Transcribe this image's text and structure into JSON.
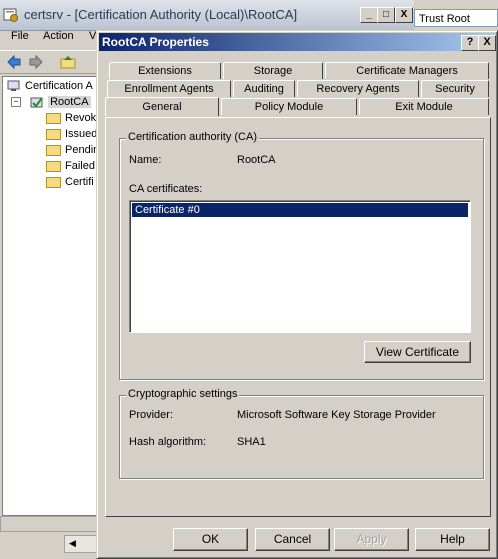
{
  "mmc": {
    "title": "certsrv - [Certification Authority (Local)\\RootCA]",
    "trust_box": "Trust Root",
    "menu": [
      "File",
      "Action",
      "V"
    ],
    "tree": {
      "root": "Certification A",
      "ca": "RootCA",
      "folders": [
        "Revok",
        "Issued",
        "Pendin",
        "Failed",
        "Certifi"
      ]
    },
    "win_buttons": [
      "_",
      "□",
      "X"
    ]
  },
  "dialog": {
    "title": "RootCA Properties",
    "help_btn": "?",
    "close_btn": "X",
    "tabs_row1": [
      "Extensions",
      "Storage",
      "Certificate Managers"
    ],
    "tabs_row2": [
      "Enrollment Agents",
      "Auditing",
      "Recovery Agents",
      "Security"
    ],
    "tabs_row3": [
      "General",
      "Policy Module",
      "Exit Module"
    ],
    "active_tab": "General",
    "ca_group": {
      "title": "Certification authority (CA)",
      "name_label": "Name:",
      "name_value": "RootCA",
      "certs_label": "CA certificates:",
      "certs": [
        "Certificate #0"
      ],
      "view_button": "View Certificate"
    },
    "crypto_group": {
      "title": "Cryptographic settings",
      "provider_label": "Provider:",
      "provider_value": "Microsoft Software Key Storage Provider",
      "hash_label": "Hash algorithm:",
      "hash_value": "SHA1"
    },
    "buttons": {
      "ok": "OK",
      "cancel": "Cancel",
      "apply": "Apply",
      "help": "Help"
    }
  }
}
